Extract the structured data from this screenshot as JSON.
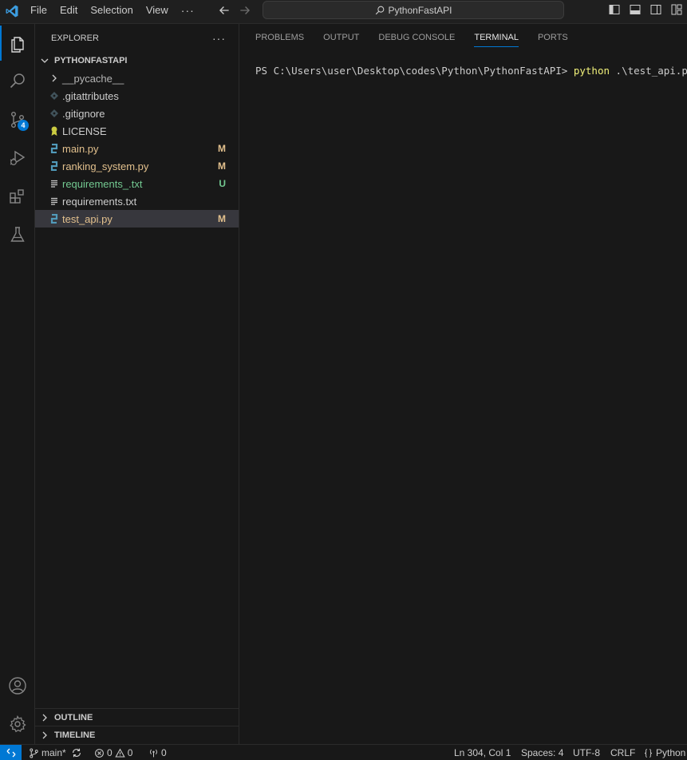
{
  "menu": {
    "items": [
      "File",
      "Edit",
      "Selection",
      "View"
    ],
    "more": "···"
  },
  "command_center": {
    "label": "PythonFastAPI"
  },
  "sidebar": {
    "title": "EXPLORER",
    "more": "···",
    "folder": "PYTHONFASTAPI",
    "files": [
      {
        "name": "__pycache__",
        "type": "folder",
        "status": ""
      },
      {
        "name": ".gitattributes",
        "type": "git",
        "status": ""
      },
      {
        "name": ".gitignore",
        "type": "git",
        "status": ""
      },
      {
        "name": "LICENSE",
        "type": "license",
        "status": ""
      },
      {
        "name": "main.py",
        "type": "python",
        "status": "M"
      },
      {
        "name": "ranking_system.py",
        "type": "python",
        "status": "M"
      },
      {
        "name": "requirements_.txt",
        "type": "text",
        "status": "U"
      },
      {
        "name": "requirements.txt",
        "type": "text",
        "status": ""
      },
      {
        "name": "test_api.py",
        "type": "python",
        "status": "M",
        "selected": true
      }
    ],
    "outline": "OUTLINE",
    "timeline": "TIMELINE"
  },
  "activity": {
    "source_control_badge": "4"
  },
  "panel": {
    "tabs": [
      "PROBLEMS",
      "OUTPUT",
      "DEBUG CONSOLE",
      "TERMINAL",
      "PORTS"
    ],
    "active_tab": "TERMINAL",
    "terminal": {
      "prompt": "PS C:\\Users\\user\\Desktop\\codes\\Python\\PythonFastAPI> ",
      "command": "python",
      "args": " .\\test_api.py"
    }
  },
  "statusbar": {
    "branch": "main*",
    "errors": "0",
    "warnings": "0",
    "ports": "0",
    "position": "Ln 304, Col 1",
    "spaces": "Spaces: 4",
    "encoding": "UTF-8",
    "eol": "CRLF",
    "language": "Python"
  },
  "colors": {
    "accent": "#0078d4",
    "modified": "#e2c08d",
    "untracked": "#73c991",
    "python_icon": "#519aba"
  }
}
